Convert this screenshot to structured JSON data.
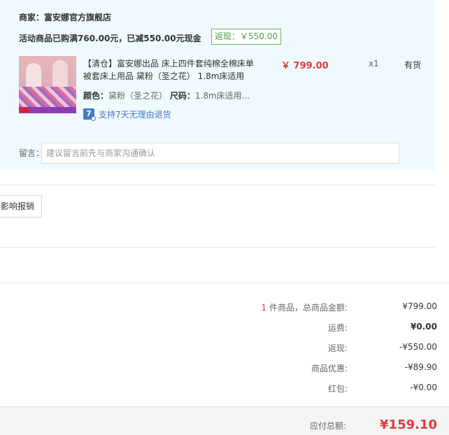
{
  "store": {
    "merchant_label": "商家：",
    "merchant_name": "富安娜官方旗舰店",
    "promo_text": "活动商品已购满760.00元，已减550.00元现金",
    "rebate_badge": "返现：￥550.00"
  },
  "product": {
    "name": "【清仓】富安娜出品 床上四件套纯棉全棉床单被套床上用品 黛粉（圣之花） 1.8m床适用",
    "price": "￥ 799.00",
    "quantity": "x1",
    "stock": "有货",
    "spec_color_label": "颜色：",
    "spec_color_value": "黛粉（圣之花）",
    "spec_size_label": "尺码：",
    "spec_size_value": "1.8m床适用...",
    "return_icon_text": "7",
    "return_policy": "支持7天无理由退货"
  },
  "note": {
    "label": "留言：",
    "placeholder": "建议留言前先与商家沟通确认"
  },
  "invoice": {
    "button_label": "影响报销"
  },
  "summary": {
    "count": "1",
    "count_suffix": " 件商品，总商品金额:",
    "subtotal": "¥799.00",
    "shipping_label": "运费:",
    "shipping_value": "¥0.00",
    "rebate_label": "返现:",
    "rebate_value": "-¥550.00",
    "discount_label": "商品优惠:",
    "discount_value": "-¥89.90",
    "redpacket_label": "红包:",
    "redpacket_value": "-¥0.00",
    "total_label": "应付总额:",
    "total_value": "¥159.10"
  },
  "colors": {
    "price_red": "#e4393c",
    "card_bg": "#eff9fe",
    "rebate_green": "#4a9f4a",
    "link_blue": "#4a78c2"
  }
}
